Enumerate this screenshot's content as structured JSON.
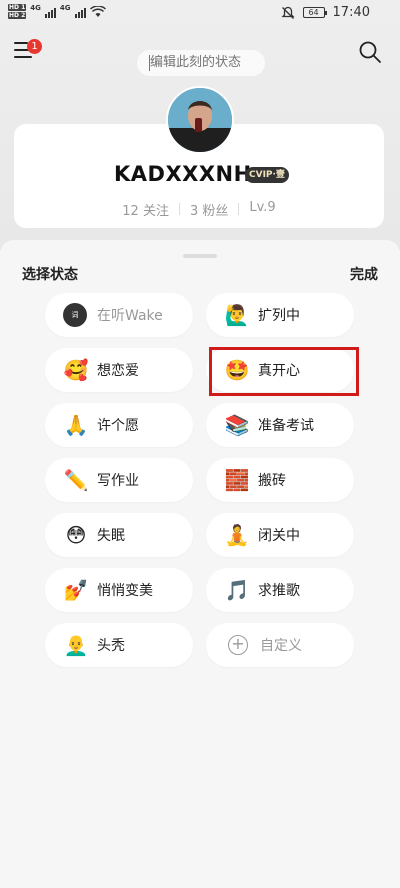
{
  "statusbar": {
    "sim1": "HD 1",
    "sim2": "HD 2",
    "net1": "4G",
    "net2": "4G",
    "battery": "64",
    "time": "17:40"
  },
  "header": {
    "menu_badge": "1",
    "status_placeholder": "编辑此刻的状态"
  },
  "profile": {
    "username": "KADXXXNH",
    "vip_label": "CVIP·壹",
    "follows": "12 关注",
    "fans": "3 粉丝",
    "level": "Lv.9"
  },
  "sheet": {
    "title": "选择状态",
    "done": "完成"
  },
  "states": [
    {
      "label": "在听Wake",
      "icon": "music-note-icon",
      "emoji": "词"
    },
    {
      "label": "扩列中",
      "icon": "waving-person-icon",
      "emoji": "🙋‍♂️"
    },
    {
      "label": "想恋爱",
      "icon": "smiling-face-with-hearts-icon",
      "emoji": "🥰"
    },
    {
      "label": "真开心",
      "icon": "star-struck-icon",
      "emoji": "🤩"
    },
    {
      "label": "许个愿",
      "icon": "folded-hands-icon",
      "emoji": "🙏"
    },
    {
      "label": "准备考试",
      "icon": "books-icon",
      "emoji": "📚"
    },
    {
      "label": "写作业",
      "icon": "pencil-icon",
      "emoji": "✏️"
    },
    {
      "label": "搬砖",
      "icon": "brick-icon",
      "emoji": "🧱"
    },
    {
      "label": "失眠",
      "icon": "flushed-face-icon",
      "emoji": "😳"
    },
    {
      "label": "闭关中",
      "icon": "meditation-icon",
      "emoji": "🧘"
    },
    {
      "label": "悄悄变美",
      "icon": "nail-polish-icon",
      "emoji": "💅"
    },
    {
      "label": "求推歌",
      "icon": "musical-note-icon",
      "emoji": "🎵"
    },
    {
      "label": "头秃",
      "icon": "bald-man-icon",
      "emoji": "👨‍🦲"
    },
    {
      "label": "自定义",
      "icon": "plus-circle-icon",
      "emoji": "+"
    }
  ],
  "colors": {
    "highlight": "#d11a1a",
    "badge": "#e8372f"
  }
}
